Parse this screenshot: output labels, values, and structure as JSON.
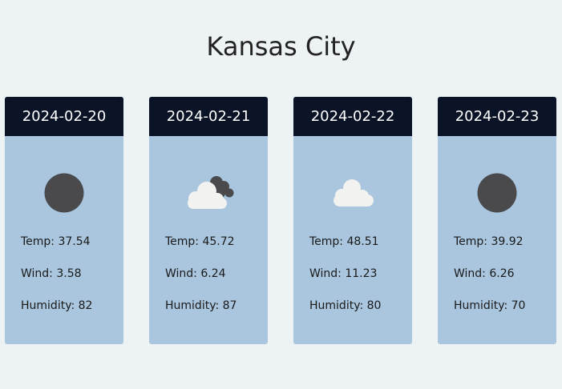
{
  "city": "Kansas City",
  "labels": {
    "temp": "Temp: ",
    "wind": "Wind: ",
    "humidity": "Humidity: "
  },
  "forecast": [
    {
      "date": "2024-02-20",
      "icon": "dark-circle-icon",
      "temp": "37.54",
      "wind": "3.58",
      "humidity": "82"
    },
    {
      "date": "2024-02-21",
      "icon": "broken-clouds-icon",
      "temp": "45.72",
      "wind": "6.24",
      "humidity": "87"
    },
    {
      "date": "2024-02-22",
      "icon": "cloud-icon",
      "temp": "48.51",
      "wind": "11.23",
      "humidity": "80"
    },
    {
      "date": "2024-02-23",
      "icon": "dark-circle-icon",
      "temp": "39.92",
      "wind": "6.26",
      "humidity": "70"
    }
  ],
  "colors": {
    "background": "#edf2f4",
    "card": "#a9c6de",
    "card_header": "#0b1327"
  }
}
